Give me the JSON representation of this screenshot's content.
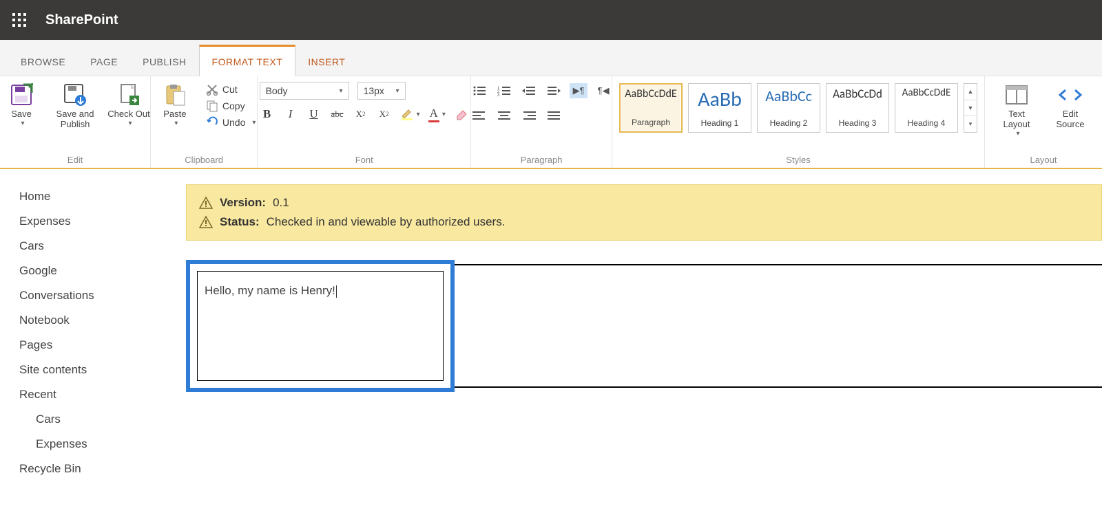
{
  "header": {
    "brand": "SharePoint"
  },
  "tabs": {
    "items": [
      {
        "label": "BROWSE"
      },
      {
        "label": "PAGE"
      },
      {
        "label": "PUBLISH"
      },
      {
        "label": "FORMAT TEXT"
      },
      {
        "label": "INSERT"
      }
    ],
    "active_index": 3
  },
  "ribbon": {
    "groups": {
      "edit": {
        "label": "Edit",
        "save": "Save",
        "save_publish": "Save and Publish",
        "check_out": "Check Out"
      },
      "clipboard": {
        "label": "Clipboard",
        "paste": "Paste",
        "cut": "Cut",
        "copy": "Copy",
        "undo": "Undo"
      },
      "font": {
        "label": "Font",
        "family": "Body",
        "size": "13px"
      },
      "paragraph": {
        "label": "Paragraph"
      },
      "styles": {
        "label": "Styles",
        "items": [
          {
            "sample": "AaBbCcDdE",
            "caption": "Paragraph",
            "size": "16px",
            "color": "#333"
          },
          {
            "sample": "AaBb",
            "caption": "Heading 1",
            "size": "30px",
            "color": "#2a6db5"
          },
          {
            "sample": "AaBbCc",
            "caption": "Heading 2",
            "size": "22px",
            "color": "#2a6db5"
          },
          {
            "sample": "AaBbCcDd",
            "caption": "Heading 3",
            "size": "17px",
            "color": "#333"
          },
          {
            "sample": "AaBbCcDdE",
            "caption": "Heading 4",
            "size": "15px",
            "color": "#333"
          }
        ],
        "selected_index": 0
      },
      "layout": {
        "label": "Layout",
        "text_layout": "Text Layout",
        "edit_source": "Edit Source"
      }
    }
  },
  "sidenav": {
    "items": [
      "Home",
      "Expenses",
      "Cars",
      "Google",
      "Conversations",
      "Notebook",
      "Pages",
      "Site contents",
      "Recent"
    ],
    "recent_children": [
      "Cars",
      "Expenses"
    ],
    "recycle": "Recycle Bin"
  },
  "banner": {
    "version_key": "Version:",
    "version_val": "0.1",
    "status_key": "Status:",
    "status_val": "Checked in and viewable by authorized users."
  },
  "editor": {
    "text": "Hello, my name is Henry!"
  }
}
